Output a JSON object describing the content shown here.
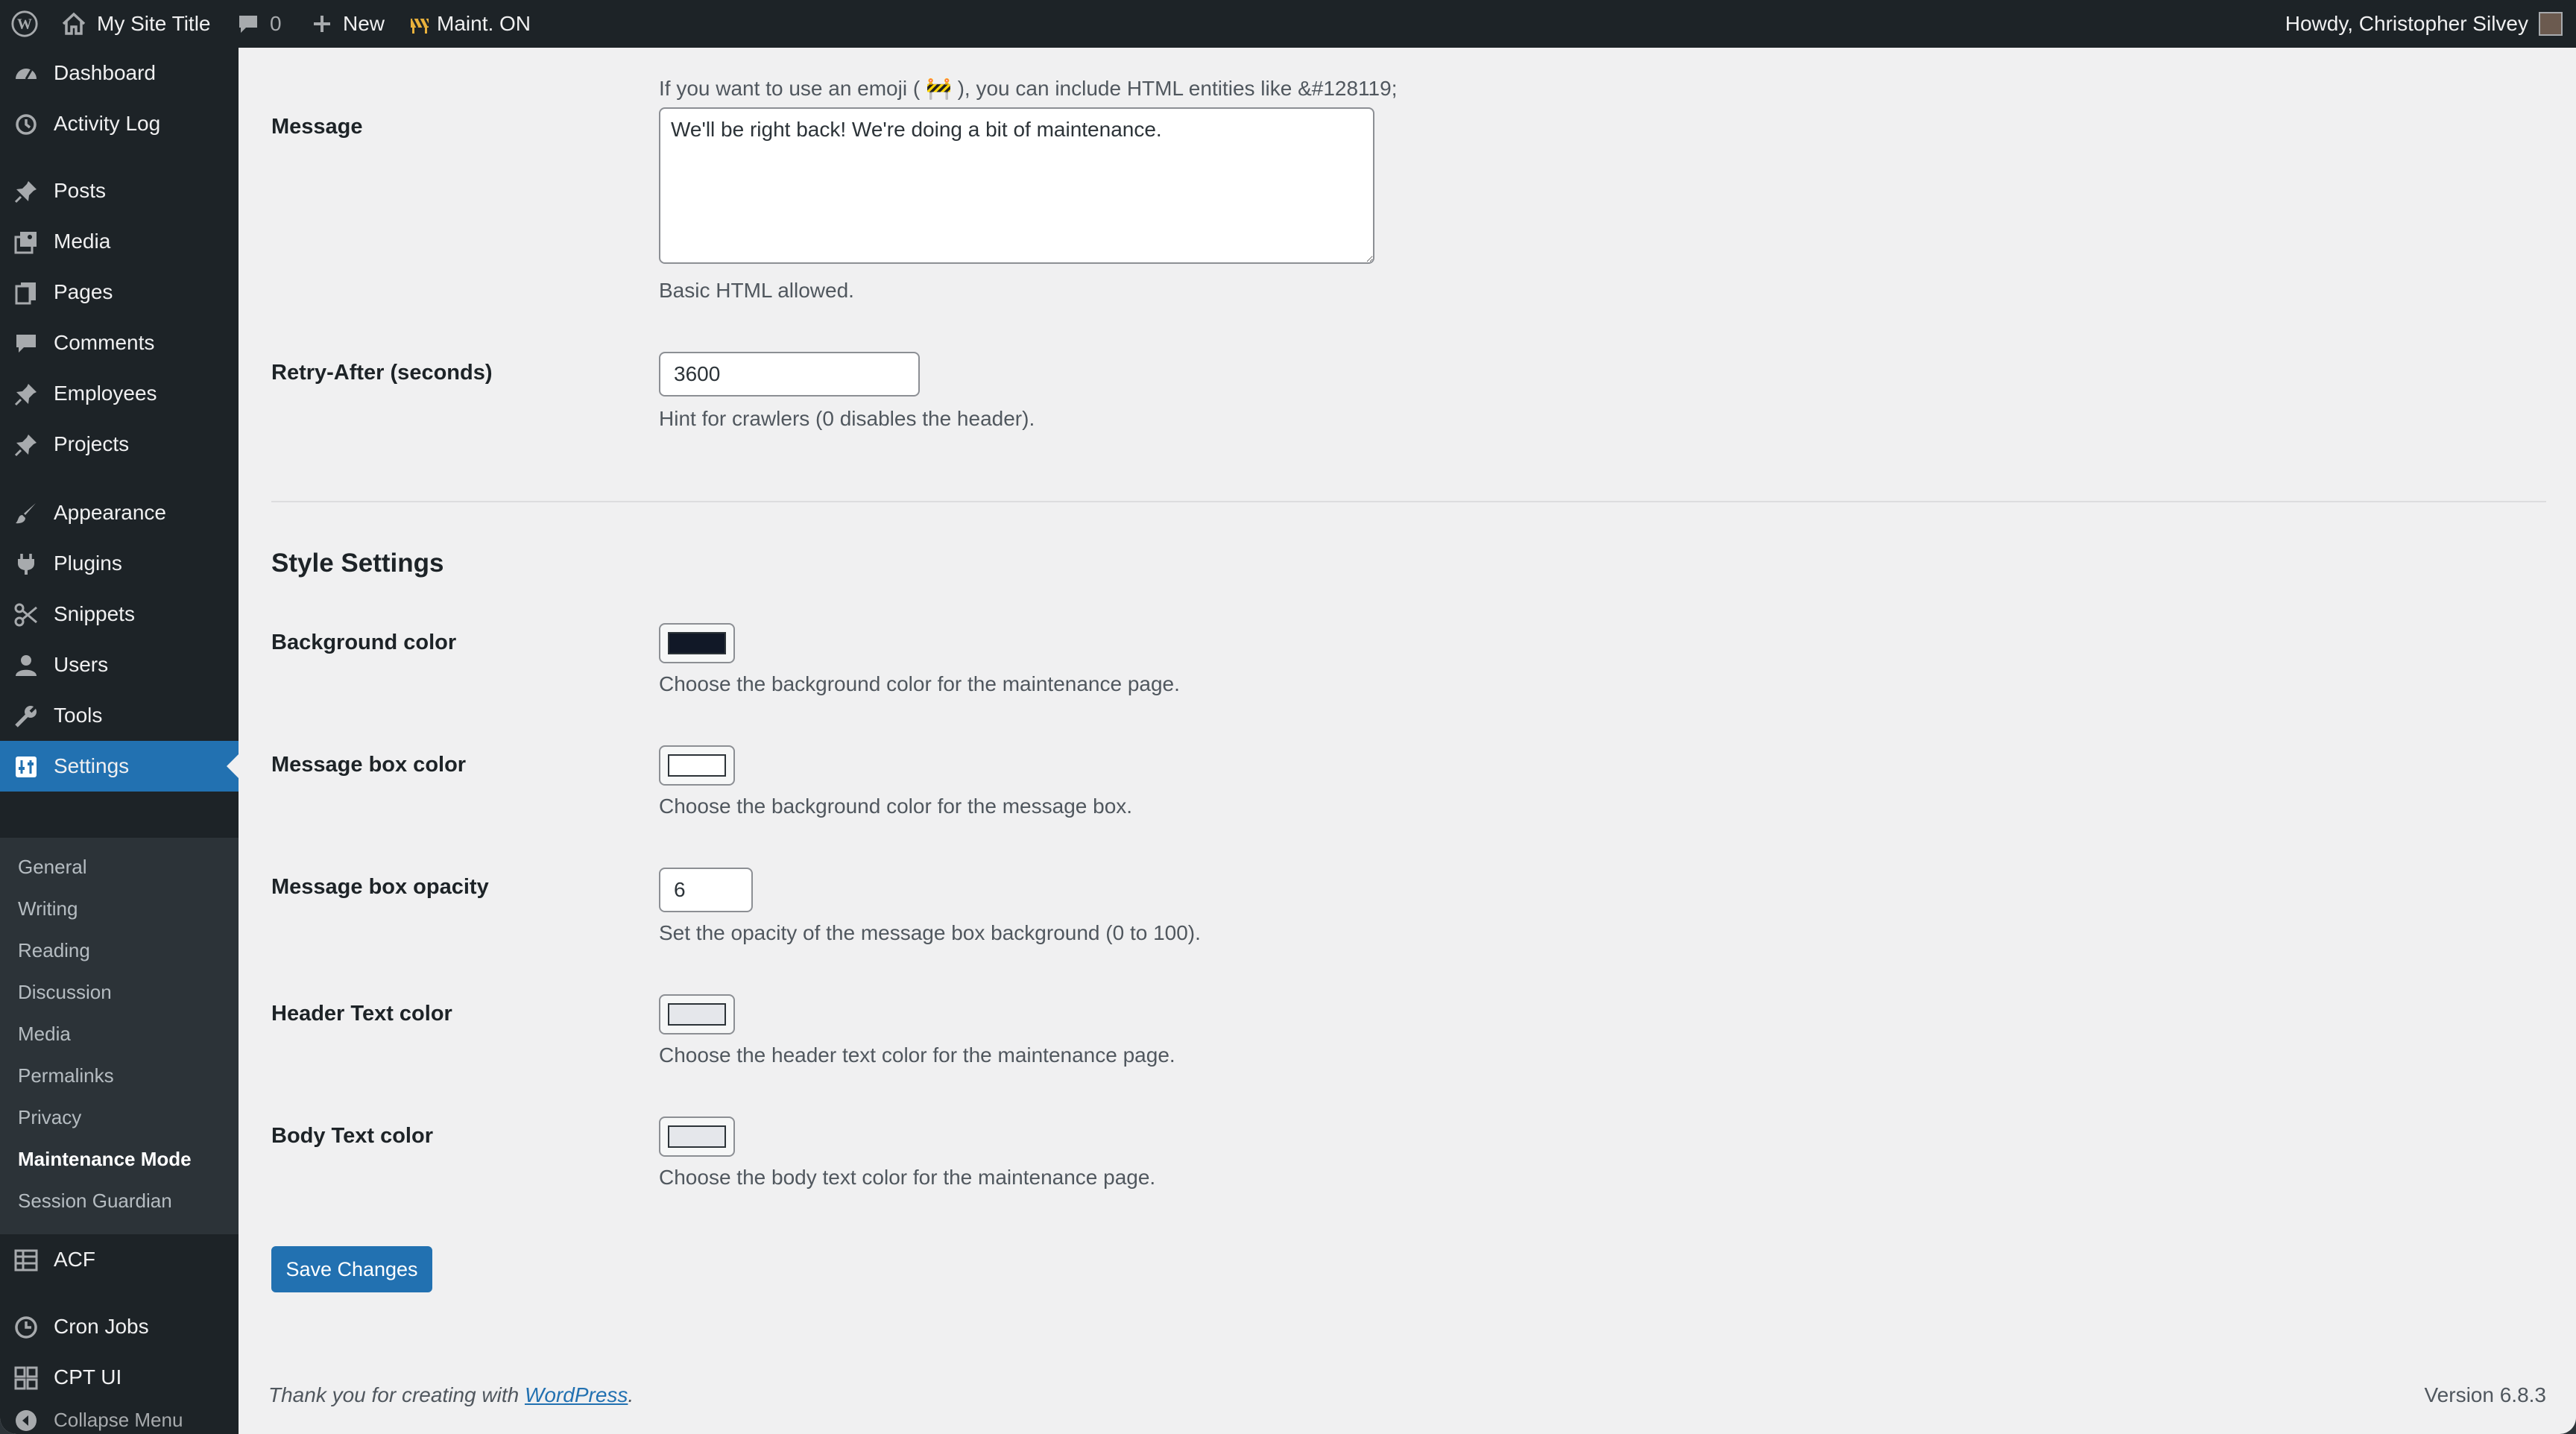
{
  "admin_bar": {
    "site_title": "My Site Title",
    "comments_count": "0",
    "new_label": "New",
    "maint_label": "Maint. ON",
    "howdy": "Howdy, Christopher Silvey"
  },
  "sidebar": {
    "items": [
      {
        "label": "Dashboard",
        "icon": "dashboard-icon"
      },
      {
        "label": "Activity Log",
        "icon": "history-icon"
      },
      {
        "label": "Posts",
        "icon": "pushpin-icon"
      },
      {
        "label": "Media",
        "icon": "media-icon"
      },
      {
        "label": "Pages",
        "icon": "pages-icon"
      },
      {
        "label": "Comments",
        "icon": "comment-icon"
      },
      {
        "label": "Employees",
        "icon": "pushpin-icon"
      },
      {
        "label": "Projects",
        "icon": "pushpin-icon"
      },
      {
        "label": "Appearance",
        "icon": "brush-icon"
      },
      {
        "label": "Plugins",
        "icon": "plug-icon"
      },
      {
        "label": "Snippets",
        "icon": "scissors-icon"
      },
      {
        "label": "Users",
        "icon": "user-icon"
      },
      {
        "label": "Tools",
        "icon": "wrench-icon"
      },
      {
        "label": "Settings",
        "icon": "settings-icon"
      },
      {
        "label": "ACF",
        "icon": "table-icon"
      },
      {
        "label": "Cron Jobs",
        "icon": "clock-icon"
      },
      {
        "label": "CPT UI",
        "icon": "grid-icon"
      },
      {
        "label": "Collapse Menu",
        "icon": "collapse-icon"
      }
    ],
    "submenu": [
      "General",
      "Writing",
      "Reading",
      "Discussion",
      "Media",
      "Permalinks",
      "Privacy",
      "Maintenance Mode",
      "Session Guardian"
    ]
  },
  "content": {
    "cut_top_text": "If you want to use an emoji ( 🚧 ), you can include HTML entities like &#128119;",
    "message": {
      "label": "Message",
      "value": "We'll be right back! We're doing a bit of maintenance.",
      "description": "Basic HTML allowed."
    },
    "retry": {
      "label": "Retry-After (seconds)",
      "value": "3600",
      "description": "Hint for crawlers (0 disables the header)."
    },
    "style_heading": "Style Settings",
    "background_color": {
      "label": "Background color",
      "description": "Choose the background color for the maintenance page.",
      "color": "#111827"
    },
    "message_box_color": {
      "label": "Message box color",
      "description": "Choose the background color for the message box.",
      "color": "#ffffff"
    },
    "opacity": {
      "label": "Message box opacity",
      "value": "6",
      "description": "Set the opacity of the message box background (0 to 100)."
    },
    "header_text_color": {
      "label": "Header Text color",
      "description": "Choose the header text color for the maintenance page.",
      "color": "#e5e7eb"
    },
    "body_text_color": {
      "label": "Body Text color",
      "description": "Choose the body text color for the maintenance page.",
      "color": "#e5e7eb"
    },
    "save_label": "Save Changes"
  },
  "footer": {
    "thanks_prefix": "Thank you for creating with ",
    "thanks_link": "WordPress",
    "thanks_suffix": ".",
    "version": "Version 6.8.3"
  }
}
